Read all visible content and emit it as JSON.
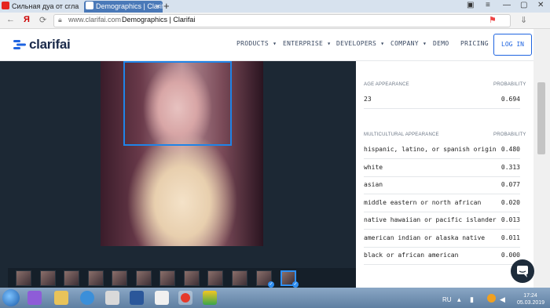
{
  "browser": {
    "tabs": [
      {
        "label": "Сильная дуа от сгла"
      },
      {
        "label": "Demographics | Clarifai",
        "active": true
      }
    ],
    "url_domain": "www.clarifai.com",
    "page_title": "Demographics | Clarifai"
  },
  "site": {
    "logo_text": "clarifai",
    "nav": [
      {
        "label": "PRODUCTS",
        "has_dropdown": true
      },
      {
        "label": "ENTERPRISE",
        "has_dropdown": true
      },
      {
        "label": "DEVELOPERS",
        "has_dropdown": true
      },
      {
        "label": "COMPANY",
        "has_dropdown": true
      },
      {
        "label": "DEMO",
        "has_dropdown": false
      },
      {
        "label": "PRICING",
        "has_dropdown": false
      }
    ],
    "login_label": "LOG IN",
    "accent_color": "#1f64e0"
  },
  "results": {
    "age": {
      "header": "AGE APPEARANCE",
      "prob_header": "PROBABILITY",
      "rows": [
        {
          "name": "23",
          "value": "0.694"
        }
      ]
    },
    "multicultural": {
      "header": "MULTICULTURAL APPEARANCE",
      "prob_header": "PROBABILITY",
      "rows": [
        {
          "name": "hispanic, latino, or spanish origin",
          "value": "0.480"
        },
        {
          "name": "white",
          "value": "0.313"
        },
        {
          "name": "asian",
          "value": "0.077"
        },
        {
          "name": "middle eastern or north african",
          "value": "0.020"
        },
        {
          "name": "native hawaiian or pacific islander",
          "value": "0.013"
        },
        {
          "name": "american indian or alaska native",
          "value": "0.011"
        },
        {
          "name": "black or african american",
          "value": "0.000"
        }
      ]
    }
  },
  "taskbar": {
    "language": "RU",
    "time": "17:24",
    "date": "05.03.2019"
  }
}
